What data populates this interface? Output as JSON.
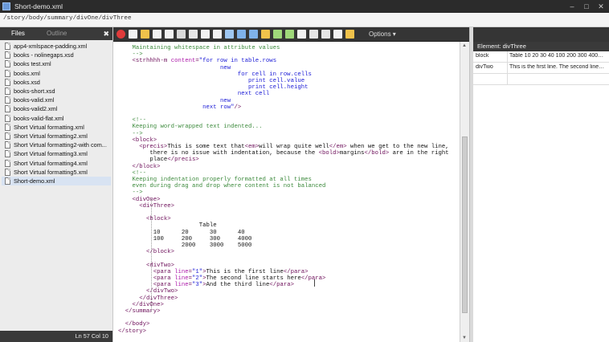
{
  "window": {
    "title": "Short-demo.xml"
  },
  "path_bar": {
    "path": "/story/body/summary/divOne/divThree"
  },
  "left_panel": {
    "tabs": [
      "Files",
      "Outline"
    ],
    "files": [
      "app4-xmlspace-padding.xml",
      "books - nolinegaps.xsd",
      "books test.xml",
      "books.xml",
      "books.xsd",
      "books-short.xsd",
      "books-valid.xml",
      "books-valid2.xml",
      "books-valid-flat.xml",
      "Short Virtual formatting.xml",
      "Short Virtual formatting2.xml",
      "Short Virtual formatting2-with com...",
      "Short Virtual formatting3.xml",
      "Short Virtual formatting4.xml",
      "Short Virtual formatting5.xml",
      "Short-demo.xml"
    ],
    "selected_file": "Short-demo.xml",
    "status": "Ln 57 Col 10"
  },
  "toolbar": {
    "options_label": "Options",
    "icons": [
      "logo-icon",
      "new-icon",
      "open-icon",
      "save-icon",
      "save-all-icon",
      "print-icon",
      "cut-icon",
      "copy-icon",
      "paste-icon",
      "find-icon",
      "undo-icon",
      "redo-icon",
      "format-icon",
      "indent-icon",
      "outdent-icon",
      "wrap-icon",
      "comment-icon",
      "uncomment-icon",
      "validate-icon",
      "edit-icon"
    ],
    "icon_colors": [
      "#e03b3b",
      "#f2f2f2",
      "#f0c24b",
      "#f2f2f2",
      "#f2f2f2",
      "#d9d9d9",
      "#e6e6e6",
      "#f2f2f2",
      "#f2f2f2",
      "#9fc7f2",
      "#7fb2ea",
      "#7fb2ea",
      "#f0c24b",
      "#9fd87a",
      "#9fd87a",
      "#f2f2f2",
      "#e6e6e6",
      "#e6e6e6",
      "#f2f2f2",
      "#f0c24b"
    ]
  },
  "editor": {
    "lines": [
      [
        [
          "cmt",
          "    Maintaining whitespace in attribute values"
        ]
      ],
      [
        [
          "cmt",
          "    -->"
        ]
      ],
      [
        [
          "tag",
          "    <strhhhh-m "
        ],
        [
          "attr",
          "content"
        ],
        [
          "tag",
          "="
        ],
        [
          "aval",
          "\"for row in table.rows"
        ]
      ],
      [
        [
          "aval",
          "                             new"
        ]
      ],
      [
        [
          "aval",
          "                                  for cell in row.cells"
        ]
      ],
      [
        [
          "aval",
          "                                     print cell.value"
        ]
      ],
      [
        [
          "aval",
          "                                     print cell.height"
        ]
      ],
      [
        [
          "aval",
          "                                  next cell"
        ]
      ],
      [
        [
          "aval",
          "                             new"
        ]
      ],
      [
        [
          "aval",
          "                        next row\""
        ],
        [
          "tag",
          "/>"
        ]
      ],
      [
        [
          "txt",
          ""
        ]
      ],
      [
        [
          "cmt",
          "    <!--"
        ]
      ],
      [
        [
          "cmt",
          "    Keeping word-wrapped text indented..."
        ]
      ],
      [
        [
          "cmt",
          "    -->"
        ]
      ],
      [
        [
          "tag",
          "    <block>"
        ]
      ],
      [
        [
          "tag",
          "      <precis>"
        ],
        [
          "txt",
          "This is some text that"
        ],
        [
          "tag",
          "<em>"
        ],
        [
          "txt",
          "will wrap quite well"
        ],
        [
          "tag",
          "</em>"
        ],
        [
          "txt",
          " when we get to the new line,"
        ]
      ],
      [
        [
          "txt",
          "         there is no issue with indentation, because the "
        ],
        [
          "tag",
          "<bold>"
        ],
        [
          "txt",
          "margins"
        ],
        [
          "tag",
          "</bold>"
        ],
        [
          "txt",
          " are in the right"
        ]
      ],
      [
        [
          "txt",
          "         place"
        ],
        [
          "tag",
          "</precis>"
        ]
      ],
      [
        [
          "tag",
          "    </block>"
        ]
      ],
      [
        [
          "cmt",
          "    <!--"
        ]
      ],
      [
        [
          "cmt",
          "    Keeping indentation properly formatted at all times"
        ]
      ],
      [
        [
          "cmt",
          "    even during drag and drop where content is not balanced"
        ]
      ],
      [
        [
          "cmt",
          "    -->"
        ]
      ],
      [
        [
          "tag",
          "    <divOne>"
        ]
      ],
      [
        [
          "tag",
          "      <divThree>"
        ]
      ],
      [
        [
          "txt",
          ""
        ]
      ],
      [
        [
          "tag",
          "        <block>"
        ]
      ],
      [
        [
          "txt",
          "                       Table"
        ]
      ],
      [
        [
          "txt",
          "          10      20      30      40"
        ]
      ],
      [
        [
          "txt",
          "          100     200     300     4000"
        ]
      ],
      [
        [
          "txt",
          "                  2000    3000    5000"
        ]
      ],
      [
        [
          "tag",
          "        </block>"
        ]
      ],
      [
        [
          "txt",
          ""
        ]
      ],
      [
        [
          "tag",
          "        <divTwo>"
        ]
      ],
      [
        [
          "tag",
          "          <para "
        ],
        [
          "attr",
          "line"
        ],
        [
          "tag",
          "="
        ],
        [
          "aval",
          "\"1\""
        ],
        [
          "tag",
          ">"
        ],
        [
          "txt",
          "This is the first line"
        ],
        [
          "tag",
          "</para>"
        ]
      ],
      [
        [
          "tag",
          "          <para "
        ],
        [
          "attr",
          "line"
        ],
        [
          "tag",
          "="
        ],
        [
          "aval",
          "\"2\""
        ],
        [
          "tag",
          ">"
        ],
        [
          "txt",
          "The second line starts here"
        ],
        [
          "tag",
          "</para>"
        ]
      ],
      [
        [
          "tag",
          "          <para "
        ],
        [
          "attr",
          "line"
        ],
        [
          "tag",
          "="
        ],
        [
          "aval",
          "\"3\""
        ],
        [
          "tag",
          ">"
        ],
        [
          "txt",
          "And the third line"
        ],
        [
          "tag",
          "</para>"
        ]
      ],
      [
        [
          "tag",
          "        </divTwo>"
        ]
      ],
      [
        [
          "tag",
          "      </divThree>"
        ]
      ],
      [
        [
          "tag",
          "    </divOne>"
        ]
      ],
      [
        [
          "tag",
          "  </summary>"
        ]
      ],
      [
        [
          "txt",
          ""
        ]
      ],
      [
        [
          "tag",
          "  </body>"
        ]
      ],
      [
        [
          "tag",
          "</story>"
        ]
      ]
    ]
  },
  "right_panel": {
    "header": "Element: divThree",
    "rows": [
      {
        "key": "block",
        "value": "Table 10 20 30 40 100 200 300 4000 ..."
      },
      {
        "key": "divTwo",
        "value": "This is the first line. The second line st..."
      },
      {
        "key": "",
        "value": ""
      }
    ]
  }
}
